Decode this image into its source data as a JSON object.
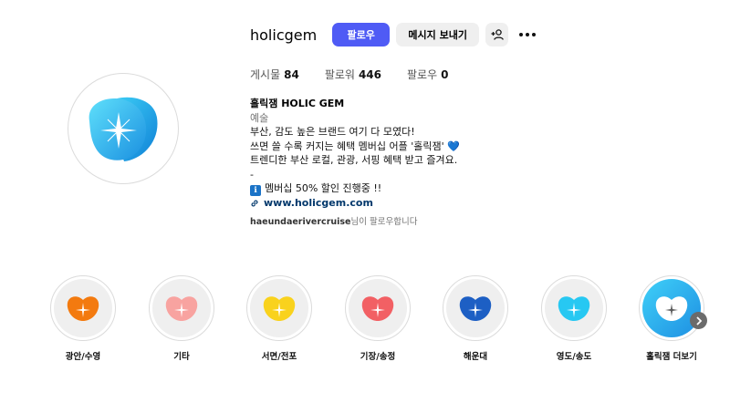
{
  "profile": {
    "username": "holicgem",
    "follow_label": "팔로우",
    "message_label": "메시지 보내기",
    "brand_color": "#4f5bf5",
    "avatar_colors": [
      "#19b3f0",
      "#2ad0f7"
    ]
  },
  "stats": [
    {
      "label": "게시물",
      "value": "84"
    },
    {
      "label": "팔로워",
      "value": "446"
    },
    {
      "label": "팔로우",
      "value": "0"
    }
  ],
  "bio": {
    "name": "홀릭잼 HOLIC GEM",
    "category": "예술",
    "line1": "부산, 감도 높은 브랜드 여기 다 모였다!",
    "line2": "쓰면 쓸 수록 커지는 혜택 멤버십 어플 '홀릭잼' 💙",
    "line3": "트렌디한 부산 로컬, 관광, 서핑 혜택 받고 즐겨요.",
    "line4": "-",
    "info_icon": "ℹ",
    "line5": "멤버십 50% 할인 진행중 !!",
    "link": "www.holicgem.com"
  },
  "followed_by": {
    "user": "haeundaerivercruise",
    "suffix": "님이 팔로우합니다"
  },
  "highlights": [
    {
      "label": "광안/수영",
      "color": "#f37a0f"
    },
    {
      "label": "기타",
      "color": "#f8a3a0"
    },
    {
      "label": "서면/전포",
      "color": "#f9d21d"
    },
    {
      "label": "기장/송정",
      "color": "#f26064"
    },
    {
      "label": "해운대",
      "color": "#1d5fc4"
    },
    {
      "label": "영도/송도",
      "color": "#27c8f2"
    },
    {
      "label": "홀릭잼 더보기",
      "color": "#ffffff"
    }
  ],
  "icons": {
    "add_person": "add-person-icon",
    "more": "more-icon",
    "link": "link-icon",
    "next": "chevron-right-icon"
  }
}
